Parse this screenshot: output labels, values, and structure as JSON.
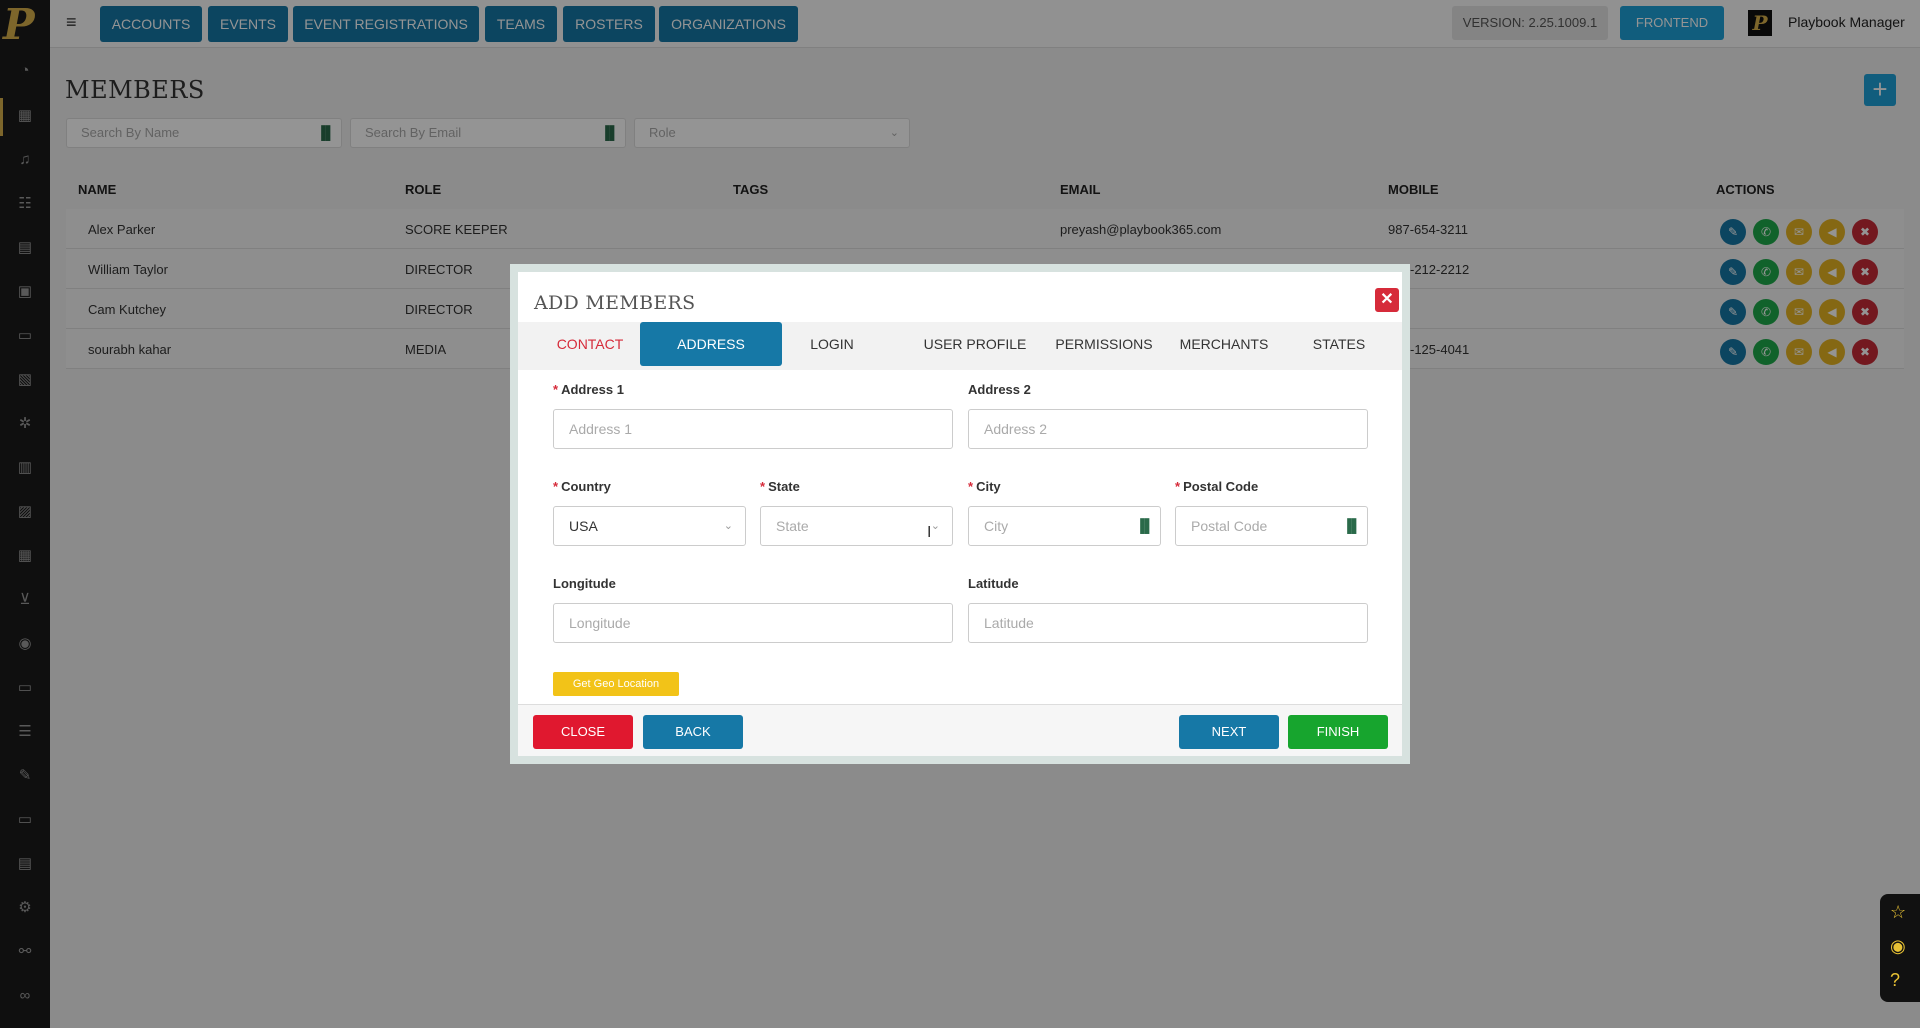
{
  "app": {
    "logo_letter": "P",
    "version_label": "VERSION: 2.25.1009.1",
    "frontend_label": "FRONTEND",
    "user_name": "Playbook Manager"
  },
  "nav": [
    "ACCOUNTS",
    "EVENTS",
    "EVENT REGISTRATIONS",
    "TEAMS",
    "ROSTERS",
    "ORGANIZATIONS"
  ],
  "page": {
    "title": "MEMBERS",
    "add_label": "+",
    "filters": {
      "name_placeholder": "Search By Name",
      "email_placeholder": "Search By Email",
      "role_placeholder": "Role"
    }
  },
  "table": {
    "headers": [
      "NAME",
      "ROLE",
      "TAGS",
      "EMAIL",
      "MOBILE",
      "ACTIONS"
    ],
    "rows": [
      {
        "name": "Alex Parker",
        "role": "SCORE KEEPER",
        "email": "preyash@playbook365.com",
        "mobile": "987-654-3211"
      },
      {
        "name": "William Taylor",
        "role": "DIRECTOR",
        "email": "",
        "mobile": "-212-2212"
      },
      {
        "name": "Cam Kutchey",
        "role": "DIRECTOR",
        "email": "",
        "mobile": ""
      },
      {
        "name": "sourabh kahar",
        "role": "MEDIA",
        "email": "",
        "mobile": "-125-4041"
      }
    ],
    "action_colors": {
      "edit": "#1678a6",
      "call": "#1ea94a",
      "mail": "#e6b422",
      "announce": "#e6b422",
      "delete": "#c62a36"
    }
  },
  "modal": {
    "title": "ADD MEMBERS",
    "close_x": "✕",
    "tabs": [
      "CONTACT",
      "ADDRESS",
      "LOGIN",
      "USER PROFILE",
      "PERMISSIONS",
      "MERCHANTS",
      "STATES"
    ],
    "active_tab": "ADDRESS",
    "fields": {
      "address1": {
        "label": "Address 1",
        "placeholder": "Address 1",
        "required": true
      },
      "address2": {
        "label": "Address 2",
        "placeholder": "Address 2",
        "required": false
      },
      "country": {
        "label": "Country",
        "value": "USA",
        "required": true
      },
      "state": {
        "label": "State",
        "placeholder": "State",
        "required": true
      },
      "city": {
        "label": "City",
        "placeholder": "City",
        "required": true
      },
      "postal": {
        "label": "Postal Code",
        "placeholder": "Postal Code",
        "required": true
      },
      "longitude": {
        "label": "Longitude",
        "placeholder": "Longitude"
      },
      "latitude": {
        "label": "Latitude",
        "placeholder": "Latitude"
      }
    },
    "geo_button": "Get Geo Location",
    "buttons": {
      "close": "CLOSE",
      "back": "BACK",
      "next": "NEXT",
      "finish": "FINISH"
    }
  }
}
